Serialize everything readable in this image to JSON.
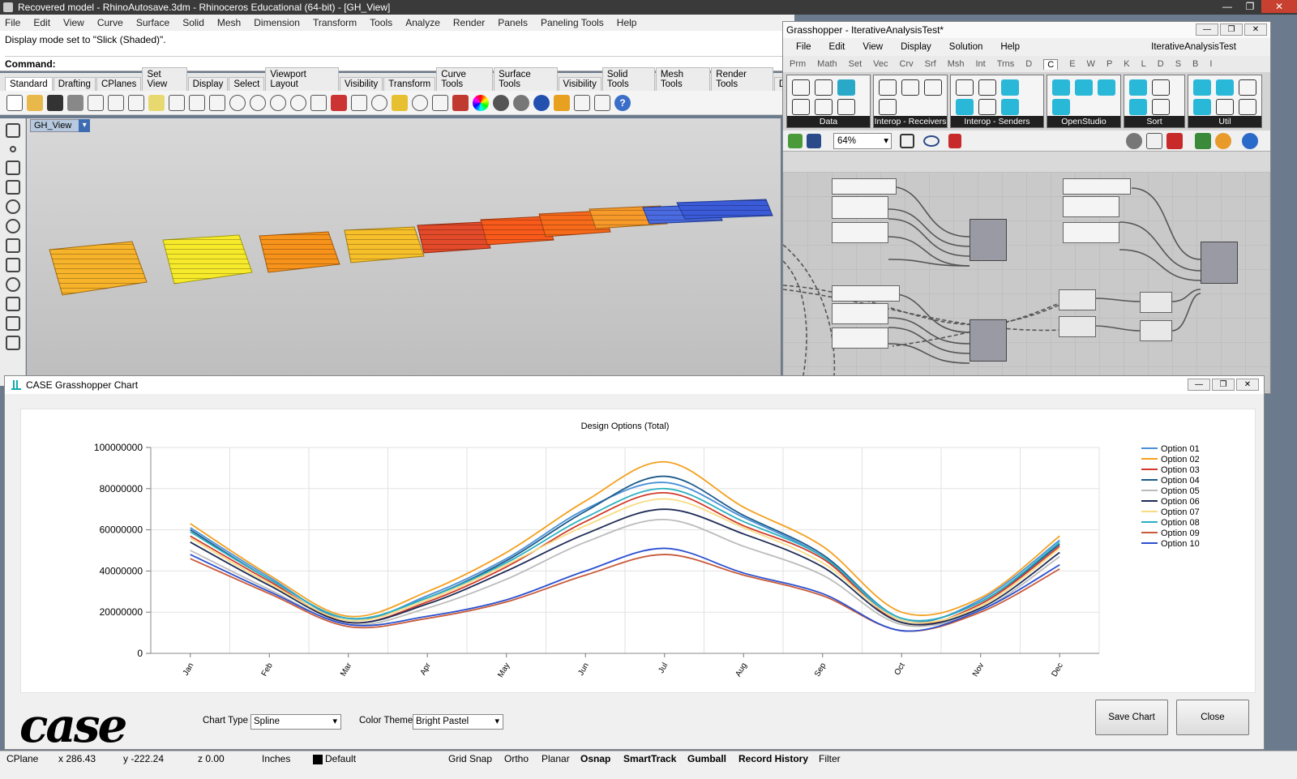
{
  "rhino": {
    "title": "Recovered model - RhinoAutosave.3dm - Rhinoceros Educational (64-bit) - [GH_View]",
    "menu": [
      "File",
      "Edit",
      "View",
      "Curve",
      "Surface",
      "Solid",
      "Mesh",
      "Dimension",
      "Transform",
      "Tools",
      "Analyze",
      "Render",
      "Panels",
      "Paneling Tools",
      "Help"
    ],
    "history_line": "Display mode set to \"Slick (Shaded)\".",
    "command_label": "Command:",
    "tabs": [
      "Standard",
      "Drafting",
      "CPlanes",
      "Set View",
      "Display",
      "Select",
      "Viewport Layout",
      "Visibility",
      "Transform",
      "Curve Tools",
      "Surface Tools",
      "Visibility",
      "Solid Tools",
      "Mesh Tools",
      "Render Tools",
      "Dr"
    ],
    "viewport_label": "GH_View"
  },
  "grasshopper": {
    "title": "Grasshopper - IterativeAnalysisTest*",
    "menu": [
      "File",
      "Edit",
      "View",
      "Display",
      "Solution",
      "Help"
    ],
    "doc_name": "IterativeAnalysisTest",
    "categories": [
      "Prm",
      "Math",
      "Set",
      "Vec",
      "Crv",
      "Srf",
      "Msh",
      "Int",
      "Trns",
      "D",
      "C",
      "E",
      "W",
      "P",
      "K",
      "L",
      "D",
      "S",
      "B",
      "I"
    ],
    "active_category": "C",
    "panels": [
      "Data",
      "Interop - Receivers",
      "Interop - Senders",
      "OpenStudio",
      "Sort",
      "Util"
    ],
    "zoom": "64%"
  },
  "chart_window": {
    "title": "CASE Grasshopper Chart",
    "logo": "case",
    "chart_type_label": "Chart Type",
    "chart_type_value": "Spline",
    "color_theme_label": "Color Theme",
    "color_theme_value": "Bright Pastel",
    "save_button": "Save Chart",
    "close_button": "Close"
  },
  "chart_data": {
    "type": "line",
    "title": "Design Options (Total)",
    "categories": [
      "Jan",
      "Feb",
      "Mar",
      "Apr",
      "May",
      "Jun",
      "Jul",
      "Aug",
      "Sep",
      "Oct",
      "Nov",
      "Dec"
    ],
    "ylim": [
      0,
      100000000
    ],
    "yticks": [
      0,
      20000000,
      40000000,
      60000000,
      80000000,
      100000000
    ],
    "ytick_labels": [
      "0",
      "20000000",
      "40000000",
      "60000000",
      "80000000",
      "100000000"
    ],
    "grid": true,
    "legend": "right",
    "series": [
      {
        "name": "Option 01",
        "color": "#4a90d8",
        "values": [
          61000000,
          37000000,
          16000000,
          28000000,
          46000000,
          70000000,
          83000000,
          66000000,
          47000000,
          16000000,
          26000000,
          55000000
        ]
      },
      {
        "name": "Option 02",
        "color": "#f4a020",
        "values": [
          63000000,
          38000000,
          18000000,
          30000000,
          49000000,
          74000000,
          93000000,
          71000000,
          52000000,
          20000000,
          27000000,
          57000000
        ]
      },
      {
        "name": "Option 03",
        "color": "#d03a2a",
        "values": [
          57000000,
          35000000,
          15000000,
          25000000,
          42000000,
          64000000,
          78000000,
          62000000,
          46000000,
          15000000,
          24000000,
          52000000
        ]
      },
      {
        "name": "Option 04",
        "color": "#1d5a8a",
        "values": [
          60000000,
          36000000,
          17000000,
          27000000,
          45000000,
          69000000,
          86000000,
          67000000,
          48000000,
          17000000,
          25000000,
          53000000
        ]
      },
      {
        "name": "Option 05",
        "color": "#bbbbbb",
        "values": [
          50000000,
          31000000,
          14000000,
          22000000,
          36000000,
          54000000,
          65000000,
          52000000,
          38000000,
          14000000,
          21000000,
          47000000
        ]
      },
      {
        "name": "Option 06",
        "color": "#1e2c55",
        "values": [
          54000000,
          33000000,
          15000000,
          24000000,
          40000000,
          58000000,
          70000000,
          58000000,
          42000000,
          15000000,
          22000000,
          49000000
        ]
      },
      {
        "name": "Option 07",
        "color": "#f7dc82",
        "values": [
          56000000,
          34000000,
          16000000,
          26000000,
          43000000,
          62000000,
          75000000,
          61000000,
          44000000,
          16000000,
          23000000,
          51000000
        ]
      },
      {
        "name": "Option 08",
        "color": "#2ab0c0",
        "values": [
          59000000,
          36000000,
          17000000,
          27000000,
          44000000,
          66000000,
          80000000,
          64000000,
          47000000,
          17000000,
          25000000,
          54000000
        ]
      },
      {
        "name": "Option 09",
        "color": "#c85a3a",
        "values": [
          46000000,
          29000000,
          13000000,
          17000000,
          25000000,
          38000000,
          48000000,
          38000000,
          28000000,
          11000000,
          20000000,
          41000000
        ]
      },
      {
        "name": "Option 10",
        "color": "#2a50d0",
        "values": [
          48000000,
          30000000,
          14000000,
          18000000,
          26000000,
          40000000,
          51000000,
          39000000,
          29000000,
          11000000,
          21000000,
          43000000
        ]
      }
    ]
  },
  "status": {
    "cplane": "CPlane",
    "x": "x 286.43",
    "y": "y -222.24",
    "z": "z 0.00",
    "units": "Inches",
    "layer": "Default",
    "grid_snap": "Grid Snap",
    "ortho": "Ortho",
    "planar": "Planar",
    "osnap": "Osnap",
    "smarttrack": "SmartTrack",
    "gumball": "Gumball",
    "record_history": "Record History",
    "filter": "Filter"
  }
}
